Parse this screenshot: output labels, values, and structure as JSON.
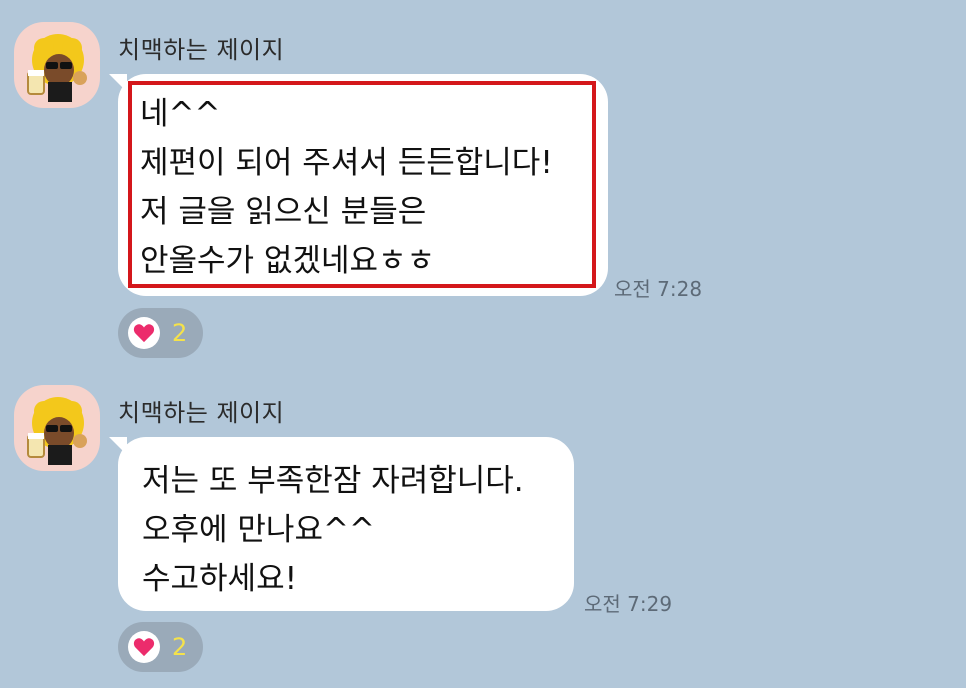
{
  "colors": {
    "background": "#b2c7d9",
    "bubble": "#ffffff",
    "highlight_border": "#d4171b",
    "reaction_pill": "#9aaab9",
    "heart": "#ec2c6c",
    "reaction_count": "#f5e24a"
  },
  "messages": [
    {
      "sender": "치맥하는 제이지",
      "lines": [
        "네^^",
        "제편이 되어 주셔서 든든합니다!",
        "저 글을 읽으신 분들은",
        "안올수가 없겠네요ㅎㅎ"
      ],
      "time": "오전 7:28",
      "reaction": {
        "icon": "heart-icon",
        "count": "2"
      }
    },
    {
      "sender": "치맥하는 제이지",
      "lines": [
        "저는 또 부족한잠 자려합니다.",
        "오후에 만나요^^",
        "수고하세요!"
      ],
      "time": "오전 7:29",
      "reaction": {
        "icon": "heart-icon",
        "count": "2"
      }
    }
  ]
}
